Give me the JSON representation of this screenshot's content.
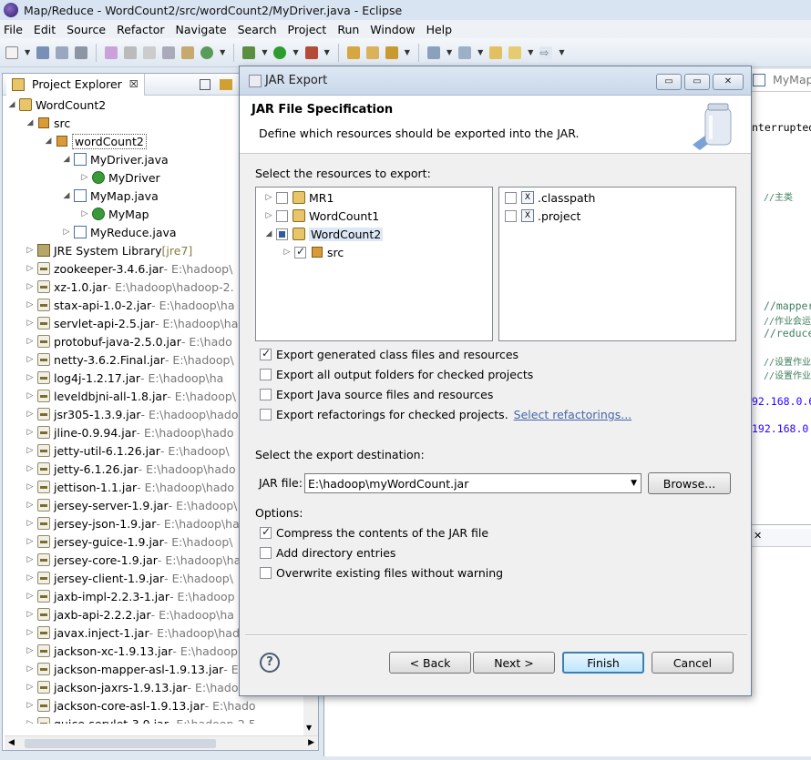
{
  "window": {
    "title": "Map/Reduce - WordCount2/src/wordCount2/MyDriver.java - Eclipse"
  },
  "menu": [
    "File",
    "Edit",
    "Source",
    "Refactor",
    "Navigate",
    "Search",
    "Project",
    "Run",
    "Window",
    "Help"
  ],
  "explorer": {
    "tab_label": "Project Explorer",
    "tab_close": "☒",
    "tree": [
      {
        "label": "WordCount2",
        "suffix": "",
        "depth": 0,
        "icon": "project-icon"
      },
      {
        "label": "src",
        "suffix": "",
        "depth": 1,
        "icon": "source-folder-icon"
      },
      {
        "label": "wordCount2",
        "suffix": "",
        "depth": 2,
        "icon": "package-icon"
      },
      {
        "label": "MyDriver.java",
        "suffix": "",
        "depth": 3,
        "icon": "java-file-icon"
      },
      {
        "label": "MyDriver",
        "suffix": "",
        "depth": 4,
        "icon": "class-icon"
      },
      {
        "label": "MyMap.java",
        "suffix": "",
        "depth": 3,
        "icon": "java-file-icon"
      },
      {
        "label": "MyMap",
        "suffix": "",
        "depth": 4,
        "icon": "class-icon"
      },
      {
        "label": "MyReduce.java",
        "suffix": "",
        "depth": 3,
        "icon": "java-file-icon"
      },
      {
        "label": "JRE System Library",
        "suffix": " [jre7]",
        "depth": 1,
        "icon": "library-icon"
      },
      {
        "label": "zookeeper-3.4.6.jar",
        "suffix": " - E:\\hadoop\\",
        "depth": 1,
        "icon": "jar-icon"
      },
      {
        "label": "xz-1.0.jar",
        "suffix": " - E:\\hadoop\\hadoop-2.",
        "depth": 1,
        "icon": "jar-icon"
      },
      {
        "label": "stax-api-1.0-2.jar",
        "suffix": " - E:\\hadoop\\ha",
        "depth": 1,
        "icon": "jar-icon"
      },
      {
        "label": "servlet-api-2.5.jar",
        "suffix": " - E:\\hadoop\\ha",
        "depth": 1,
        "icon": "jar-icon"
      },
      {
        "label": "protobuf-java-2.5.0.jar",
        "suffix": " - E:\\hado",
        "depth": 1,
        "icon": "jar-icon"
      },
      {
        "label": "netty-3.6.2.Final.jar",
        "suffix": " - E:\\hadoop\\",
        "depth": 1,
        "icon": "jar-icon"
      },
      {
        "label": "log4j-1.2.17.jar",
        "suffix": " - E:\\hadoop\\ha",
        "depth": 1,
        "icon": "jar-icon"
      },
      {
        "label": "leveldbjni-all-1.8.jar",
        "suffix": " - E:\\hadoop\\",
        "depth": 1,
        "icon": "jar-icon"
      },
      {
        "label": "jsr305-1.3.9.jar",
        "suffix": " - E:\\hadoop\\hado",
        "depth": 1,
        "icon": "jar-icon"
      },
      {
        "label": "jline-0.9.94.jar",
        "suffix": " - E:\\hadoop\\hado",
        "depth": 1,
        "icon": "jar-icon"
      },
      {
        "label": "jetty-util-6.1.26.jar",
        "suffix": " - E:\\hadoop\\",
        "depth": 1,
        "icon": "jar-icon"
      },
      {
        "label": "jetty-6.1.26.jar",
        "suffix": " - E:\\hadoop\\hado",
        "depth": 1,
        "icon": "jar-icon"
      },
      {
        "label": "jettison-1.1.jar",
        "suffix": " - E:\\hadoop\\hado",
        "depth": 1,
        "icon": "jar-icon"
      },
      {
        "label": "jersey-server-1.9.jar",
        "suffix": " - E:\\hadoop\\",
        "depth": 1,
        "icon": "jar-icon"
      },
      {
        "label": "jersey-json-1.9.jar",
        "suffix": " - E:\\hadoop\\ha",
        "depth": 1,
        "icon": "jar-icon"
      },
      {
        "label": "jersey-guice-1.9.jar",
        "suffix": " - E:\\hadoop\\",
        "depth": 1,
        "icon": "jar-icon"
      },
      {
        "label": "jersey-core-1.9.jar",
        "suffix": " - E:\\hadoop\\ha",
        "depth": 1,
        "icon": "jar-icon"
      },
      {
        "label": "jersey-client-1.9.jar",
        "suffix": " - E:\\hadoop\\",
        "depth": 1,
        "icon": "jar-icon"
      },
      {
        "label": "jaxb-impl-2.2.3-1.jar",
        "suffix": " - E:\\hadoop",
        "depth": 1,
        "icon": "jar-icon"
      },
      {
        "label": "jaxb-api-2.2.2.jar",
        "suffix": " - E:\\hadoop\\ha",
        "depth": 1,
        "icon": "jar-icon"
      },
      {
        "label": "javax.inject-1.jar",
        "suffix": " - E:\\hadoop\\had",
        "depth": 1,
        "icon": "jar-icon"
      },
      {
        "label": "jackson-xc-1.9.13.jar",
        "suffix": " - E:\\hadoop",
        "depth": 1,
        "icon": "jar-icon"
      },
      {
        "label": "jackson-mapper-asl-1.9.13.jar",
        "suffix": " - E",
        "depth": 1,
        "icon": "jar-icon"
      },
      {
        "label": "jackson-jaxrs-1.9.13.jar",
        "suffix": " - E:\\hado",
        "depth": 1,
        "icon": "jar-icon"
      },
      {
        "label": "jackson-core-asl-1.9.13.jar",
        "suffix": " - E:\\hado",
        "depth": 1,
        "icon": "jar-icon"
      },
      {
        "label": "guice-servlet-3.0.jar",
        "suffix": " - E:\\hadoop-2.5",
        "depth": 1,
        "icon": "jar-icon"
      }
    ]
  },
  "editor": {
    "tab_label": "MyMap",
    "lines": [
      {
        "text": "nterrupted",
        "color": "#000"
      },
      {
        "text": "//主类",
        "color": "#3f7f5f"
      },
      {
        "text": "//mapper",
        "color": "#3f7f5f"
      },
      {
        "text": "//作业会运行",
        "color": "#3f7f5f"
      },
      {
        "text": "//reduce",
        "color": "#3f7f5f"
      },
      {
        "text": "//设置作业输",
        "color": "#3f7f5f"
      },
      {
        "text": "//设置作业输",
        "color": "#3f7f5f"
      },
      {
        "text": "92.168.0.6",
        "color": "#2a00ff"
      },
      {
        "text": "192.168.0.",
        "color": "#2a00ff"
      }
    ]
  },
  "dialog": {
    "title": "JAR Export",
    "btn_min": "▭",
    "btn_max": "▭",
    "btn_close": "✕",
    "heading": "JAR File Specification",
    "description": "Define which resources should be exported into the JAR.",
    "resources_label": "Select the resources to export:",
    "left_list": [
      {
        "label": "MR1",
        "state": "off",
        "twisty": "▷",
        "indent": 0,
        "icon": "project-icon"
      },
      {
        "label": "WordCount1",
        "state": "off",
        "twisty": "▷",
        "indent": 0,
        "icon": "project-icon"
      },
      {
        "label": "WordCount2",
        "state": "part",
        "twisty": "◢",
        "indent": 0,
        "icon": "project-icon",
        "selected": true
      },
      {
        "label": "src",
        "state": "on",
        "twisty": "▷",
        "indent": 1,
        "icon": "source-folder-icon"
      }
    ],
    "right_list": [
      {
        "label": ".classpath",
        "state": "off"
      },
      {
        "label": ".project",
        "state": "off"
      }
    ],
    "export_options": [
      {
        "label": "Export generated class files and resources",
        "checked": true
      },
      {
        "label": "Export all output folders for checked projects",
        "checked": false
      },
      {
        "label": "Export Java source files and resources",
        "checked": false
      },
      {
        "label": "Export refactorings for checked projects.",
        "checked": false,
        "link": "Select refactorings..."
      }
    ],
    "destination_label": "Select the export destination:",
    "jar_file_label": "JAR file:",
    "jar_file_value": "E:\\hadoop\\myWordCount.jar",
    "browse_label": "Browse...",
    "options_label": "Options:",
    "options": [
      {
        "label": "Compress the contents of the JAR file",
        "checked": true
      },
      {
        "label": "Add directory entries",
        "checked": false
      },
      {
        "label": "Overwrite existing files without warning",
        "checked": false
      }
    ],
    "help": "?",
    "buttons": {
      "back": "< Back",
      "next": "Next >",
      "finish": "Finish",
      "cancel": "Cancel"
    }
  }
}
